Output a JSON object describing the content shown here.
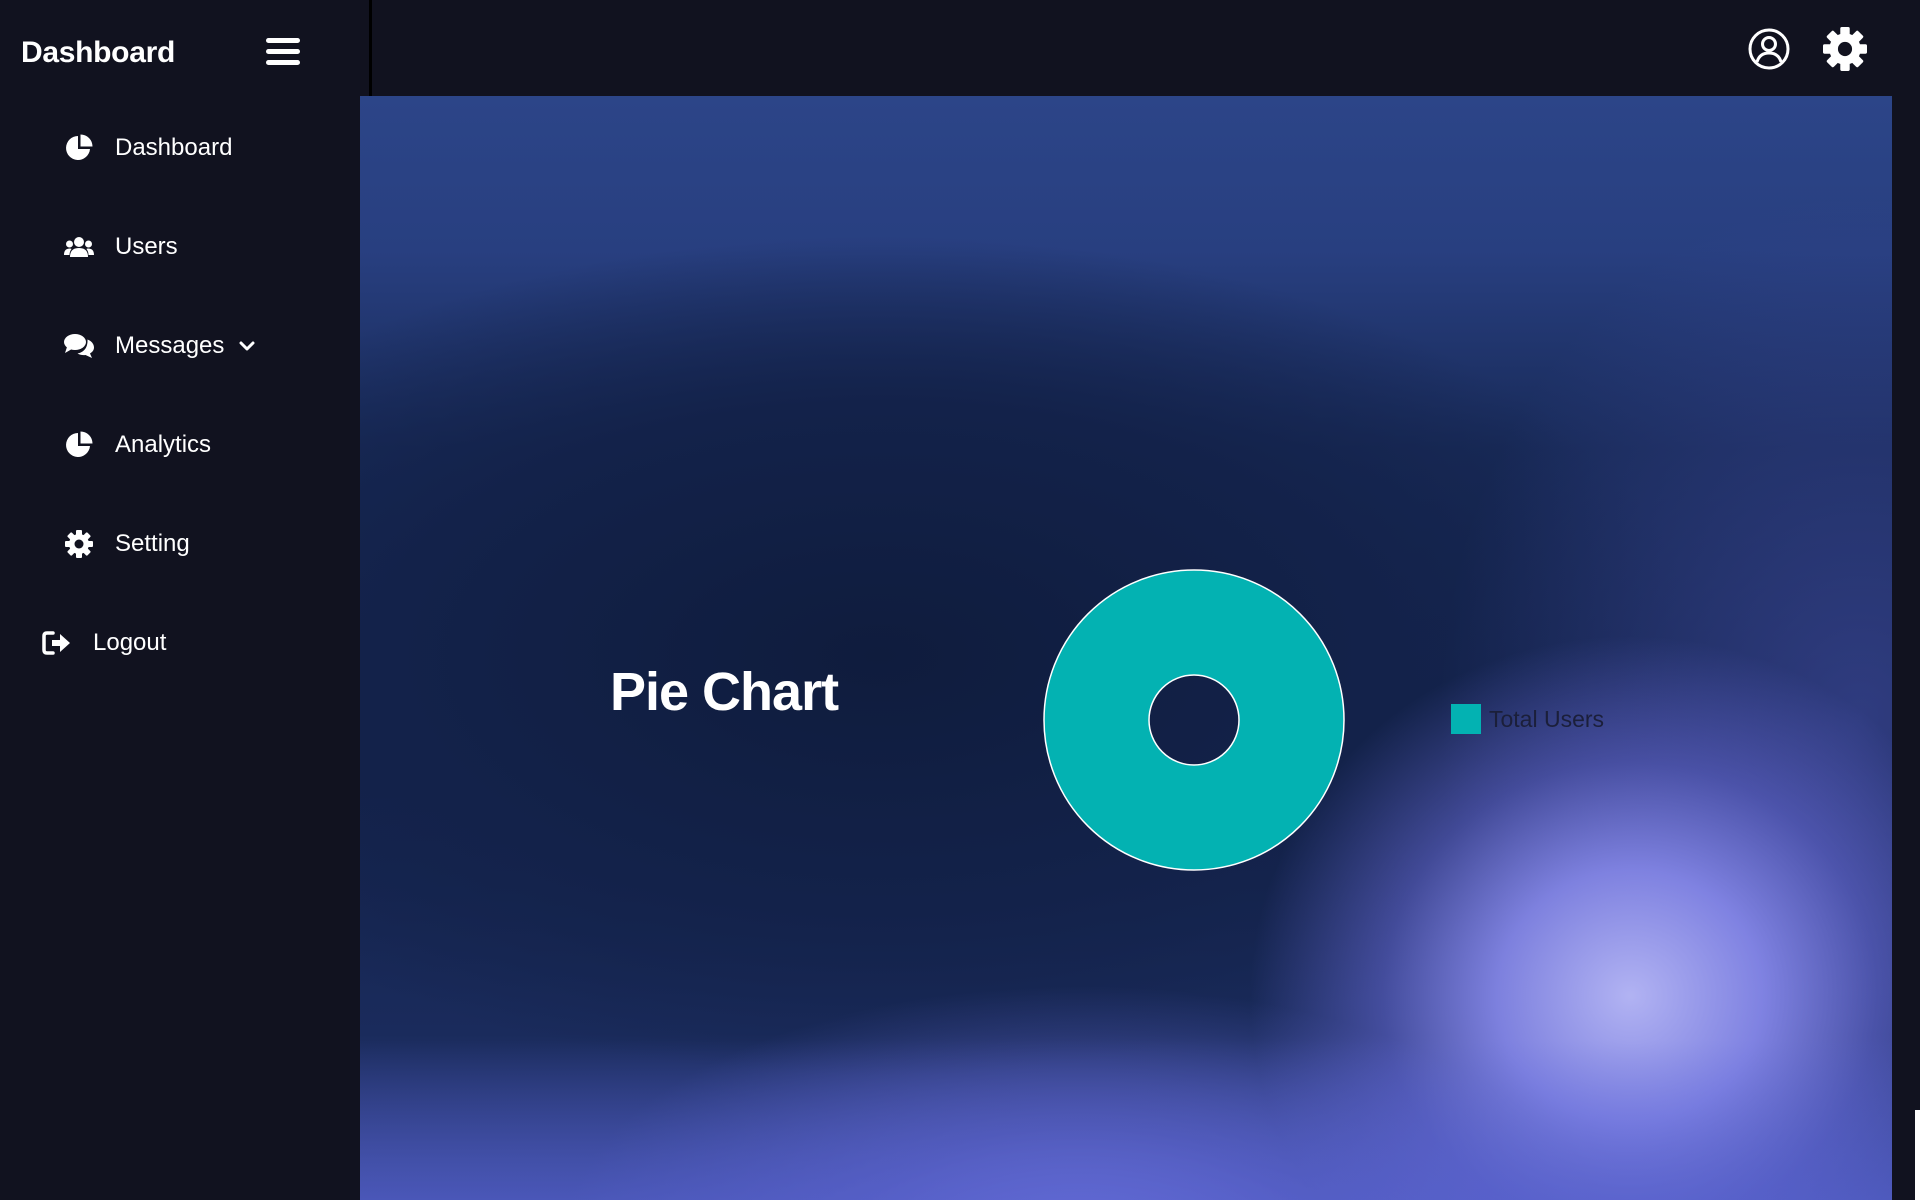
{
  "sidebar": {
    "brand": "Dashboard",
    "items": [
      {
        "label": "Dashboard",
        "icon": "pie-chart-icon"
      },
      {
        "label": "Users",
        "icon": "users-icon"
      },
      {
        "label": "Messages",
        "icon": "comments-icon",
        "has_submenu": true
      },
      {
        "label": "Analytics",
        "icon": "pie-chart-icon"
      },
      {
        "label": "Setting",
        "icon": "gear-icon"
      }
    ],
    "logout": {
      "label": "Logout",
      "icon": "sign-out-icon"
    }
  },
  "topbar": {
    "icons": [
      "user-circle-icon",
      "gear-icon"
    ]
  },
  "main": {
    "title": "Pie Chart"
  },
  "chart_data": {
    "type": "pie",
    "title": "Pie Chart",
    "categories": [
      "Total Users"
    ],
    "values": [
      1
    ],
    "colors": [
      "#03b2b2"
    ],
    "legend": "right"
  },
  "colors": {
    "sidebar_bg": "#11121f",
    "accent_teal": "#03b2b2",
    "text": "#ffffff"
  }
}
